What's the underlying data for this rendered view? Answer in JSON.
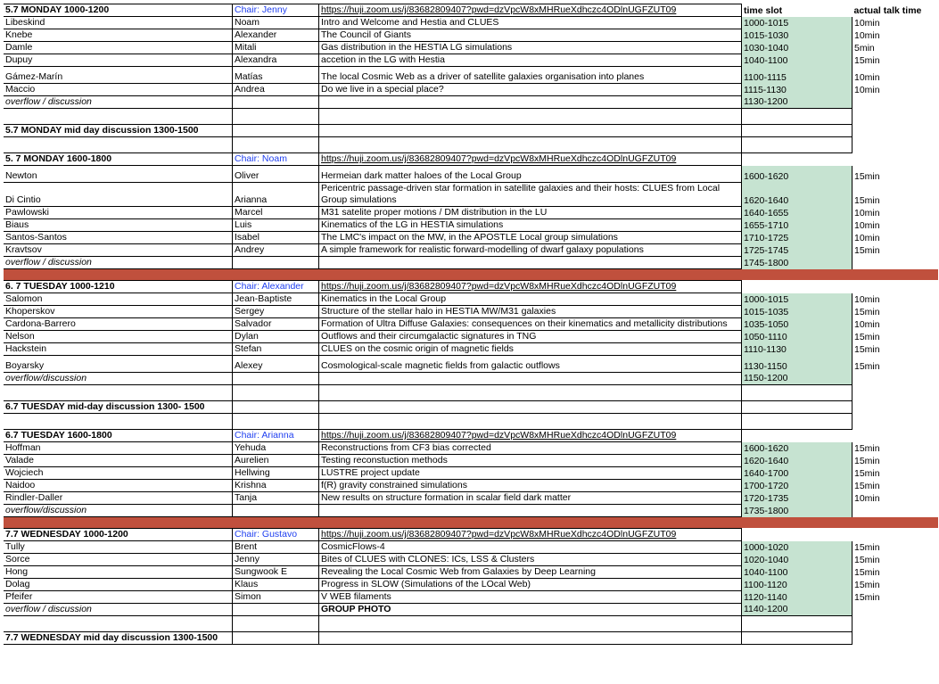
{
  "sections": [
    {
      "kind": "header",
      "title": "5.7 MONDAY 1000-1200",
      "chair": "Chair: Jenny",
      "link": "https://huji.zoom.us/j/83682809407?pwd=dzVpcW8xMHRueXdhczc4ODlnUGFZUT09",
      "slot_header": "time slot",
      "actual_header": "actual talk time"
    },
    {
      "kind": "talk",
      "last": "Libeskind",
      "first": "Noam",
      "title": "Intro and Welcome and Hestia and CLUES",
      "slot": "1000-1015",
      "actual": "10min"
    },
    {
      "kind": "talk",
      "last": "Knebe",
      "first": "Alexander",
      "title": "The Council of Giants",
      "slot": "1015-1030",
      "actual": "10min"
    },
    {
      "kind": "talk",
      "last": "Damle",
      "first": "Mitali",
      "title": "Gas distribution in the HESTIA LG simulations",
      "slot": "1030-1040",
      "actual": "5min"
    },
    {
      "kind": "talk",
      "last": "Dupuy",
      "first": "Alexandra",
      "title": "accetion in the LG with Hestia",
      "slot": "1040-1100",
      "actual": "15min"
    },
    {
      "kind": "talk",
      "tall": true,
      "last": "Gámez-Marín",
      "first": "Matías",
      "title": "The local Cosmic Web as a driver of satellite galaxies organisation into planes",
      "slot": "1100-1115",
      "actual": "10min"
    },
    {
      "kind": "talk",
      "last": "Maccio",
      "first": "Andrea",
      "title": "Do we live in a special place?",
      "slot": "1115-1130",
      "actual": "10min"
    },
    {
      "kind": "overflow",
      "label": "overflow / discussion",
      "title": "",
      "slot": "1130-1200"
    },
    {
      "kind": "gap"
    },
    {
      "kind": "discussion",
      "title": "5.7 MONDAY mid day discussion 1300-1500"
    },
    {
      "kind": "gap"
    },
    {
      "kind": "header",
      "title": "5. 7 MONDAY 1600-1800",
      "chair": "Chair: Noam",
      "link": "https://huji.zoom.us/j/83682809407?pwd=dzVpcW8xMHRueXdhczc4ODlnUGFZUT09",
      "slot_header": "",
      "actual_header": ""
    },
    {
      "kind": "talk",
      "tall": true,
      "last": "Newton",
      "first": "Oliver",
      "title": "Hermeian dark matter haloes of the Local Group",
      "slot": "1600-1620",
      "actual": "15min"
    },
    {
      "kind": "talk",
      "last": "Di Cintio",
      "first": "Arianna",
      "title": "Pericentric passage-driven star formation in satellite galaxies and their hosts: CLUES from Local Group simulations",
      "slot": "1620-1640",
      "actual": "15min"
    },
    {
      "kind": "talk",
      "last": "Pawlowski",
      "first": "Marcel",
      "title": "M31 satelite proper motions / DM distribution in the LU",
      "slot": "1640-1655",
      "actual": "10min"
    },
    {
      "kind": "talk",
      "last": "Biaus",
      "first": "Luis",
      "title": "Kinematics of the LG in HESTIA simulations",
      "slot": "1655-1710",
      "actual": "10min"
    },
    {
      "kind": "talk",
      "last": "Santos-Santos",
      "first": "Isabel",
      "title": "The LMC's impact on the MW, in the APOSTLE Local group simulations",
      "slot": "1710-1725",
      "actual": "10min"
    },
    {
      "kind": "talk",
      "last": "Kravtsov",
      "first": "Andrey",
      "title": "A simple framework for realistic forward-modelling of dwarf galaxy populations",
      "slot": "1725-1745",
      "actual": "15min"
    },
    {
      "kind": "overflow",
      "label": "overflow / discussion",
      "title": "",
      "slot": "1745-1800"
    },
    {
      "kind": "separator"
    },
    {
      "kind": "header",
      "title": "6. 7 TUESDAY 1000-1210",
      "chair": "Chair: Alexander",
      "link": "https://huji.zoom.us/j/83682809407?pwd=dzVpcW8xMHRueXdhczc4ODlnUGFZUT09",
      "slot_header": "",
      "actual_header": ""
    },
    {
      "kind": "talk",
      "last": "Salomon",
      "first": "Jean-Baptiste",
      "title": "Kinematics in the Local Group",
      "slot": "1000-1015",
      "actual": "10min"
    },
    {
      "kind": "talk",
      "last": "Khoperskov",
      "first": "Sergey",
      "title": "Structure of the stellar halo in HESTIA MW/M31 galaxies",
      "slot": "1015-1035",
      "actual": "15min"
    },
    {
      "kind": "talk",
      "last": "Cardona-Barrero",
      "first": "Salvador",
      "title": "Formation of Ultra Diffuse Galaxies: consequences on their kinematics and metallicity distributions",
      "slot": "1035-1050",
      "actual": "10min"
    },
    {
      "kind": "talk",
      "last": "Nelson",
      "first": "Dylan",
      "title": "Outflows and their circumgalactic signatures in TNG",
      "slot": "1050-1110",
      "actual": "15min"
    },
    {
      "kind": "talk",
      "last": "Hackstein",
      "first": "Stefan",
      "title": "CLUES on the cosmic origin of magnetic fields",
      "slot": "1110-1130",
      "actual": "15min"
    },
    {
      "kind": "talk",
      "tall": true,
      "last": "Boyarsky",
      "first": "Alexey",
      "title": "Cosmological-scale magnetic fields from galactic outflows",
      "slot": "1130-1150",
      "actual": "15min"
    },
    {
      "kind": "overflow",
      "label": "overflow/discussion",
      "title": "",
      "slot": "1150-1200"
    },
    {
      "kind": "gap"
    },
    {
      "kind": "discussion",
      "title": "6.7 TUESDAY mid-day discussion 1300- 1500"
    },
    {
      "kind": "gap"
    },
    {
      "kind": "header",
      "title": "6.7 TUESDAY 1600-1800",
      "chair": "Chair: Arianna",
      "link": "https://huji.zoom.us/j/83682809407?pwd=dzVpcW8xMHRueXdhczc4ODlnUGFZUT09",
      "slot_header": "",
      "actual_header": ""
    },
    {
      "kind": "talk",
      "last": "Hoffman",
      "first": "Yehuda",
      "title": "Reconstructions from CF3 bias corrected",
      "slot": "1600-1620",
      "actual": "15min"
    },
    {
      "kind": "talk",
      "last": "Valade",
      "first": "Aurelien",
      "title": "Testing reconstuction methods",
      "slot": "1620-1640",
      "actual": "15min"
    },
    {
      "kind": "talk",
      "last": "Wojciech",
      "first": "Hellwing",
      "title": "LUSTRE project update",
      "slot": "1640-1700",
      "actual": "15min"
    },
    {
      "kind": "talk",
      "last": "Naidoo",
      "first": "Krishna",
      "title": "f(R) gravity constrained simulations",
      "slot": "1700-1720",
      "actual": "15min"
    },
    {
      "kind": "talk",
      "last": "Rindler-Daller",
      "first": "Tanja",
      "title": "New results on structure formation in scalar field dark matter",
      "slot": "1720-1735",
      "actual": "10min"
    },
    {
      "kind": "overflow",
      "label": "overflow/discussion",
      "title": "",
      "slot": "1735-1800"
    },
    {
      "kind": "separator"
    },
    {
      "kind": "header",
      "title": "7.7 WEDNESDAY 1000-1200",
      "chair": "Chair: Gustavo",
      "link": "https://huji.zoom.us/j/83682809407?pwd=dzVpcW8xMHRueXdhczc4ODlnUGFZUT09",
      "slot_header": "",
      "actual_header": ""
    },
    {
      "kind": "talk",
      "last": "Tully",
      "first": "Brent",
      "title": "CosmicFlows-4",
      "slot": "1000-1020",
      "actual": "15min"
    },
    {
      "kind": "talk",
      "last": "Sorce",
      "first": "Jenny",
      "title": "Bites of CLUES with CLONES: ICs, LSS & Clusters",
      "slot": "1020-1040",
      "actual": "15min"
    },
    {
      "kind": "talk",
      "last": "Hong",
      "first": "Sungwook E",
      "title": "Revealing the Local Cosmic Web from Galaxies by Deep Learning",
      "slot": "1040-1100",
      "actual": "15min"
    },
    {
      "kind": "talk",
      "last": "Dolag",
      "first": "Klaus",
      "title": "Progress in SLOW (Simulations of the LOcal Web)",
      "slot": "1100-1120",
      "actual": "15min"
    },
    {
      "kind": "talk",
      "last": "Pfeifer",
      "first": "Simon",
      "title": "V WEB filaments",
      "slot": "1120-1140",
      "actual": "15min"
    },
    {
      "kind": "overflow",
      "label": "overflow / discussion",
      "title": "GROUP PHOTO",
      "slot": "1140-1200"
    },
    {
      "kind": "gap"
    },
    {
      "kind": "discussion",
      "title": "7.7 WEDNESDAY mid day discussion 1300-1500"
    }
  ]
}
